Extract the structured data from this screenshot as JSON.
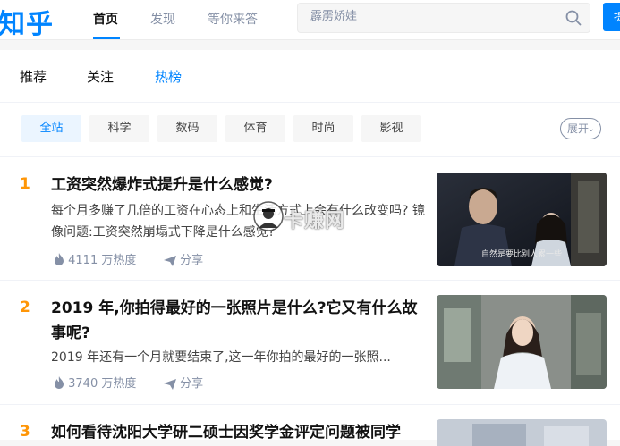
{
  "header": {
    "logo": "知乎",
    "nav": [
      "首页",
      "发现",
      "等你来答"
    ],
    "search_placeholder": "霹雳娇娃",
    "ask_label": "提"
  },
  "tabs": [
    "推荐",
    "关注",
    "热榜"
  ],
  "categories": [
    "全站",
    "科学",
    "数码",
    "体育",
    "时尚",
    "影视"
  ],
  "expand_label": "展开",
  "items": [
    {
      "rank": "1",
      "title": "工资突然爆炸式提升是什么感觉?",
      "excerpt": "每个月多赚了几倍的工资在心态上和生活方式上会有什么改变吗? 镜像问题:工资突然崩塌式下降是什么感觉?",
      "heat": "4111 万热度",
      "share": "分享",
      "thumb_caption": "自然是要比别人累一些"
    },
    {
      "rank": "2",
      "title": "2019 年,你拍得最好的一张照片是什么?它又有什么故事呢?",
      "excerpt": "2019 年还有一个月就要结束了,这一年你拍的最好的一张照...",
      "heat": "3740 万热度",
      "share": "分享"
    },
    {
      "rank": "3",
      "title": "如何看待沈阳大学研二硕士因奖学金评定问题被同学"
    }
  ],
  "watermark": "卡赚网",
  "colors": {
    "brand": "#0084ff",
    "rank": "#ff9607",
    "meta": "#8590a6"
  }
}
